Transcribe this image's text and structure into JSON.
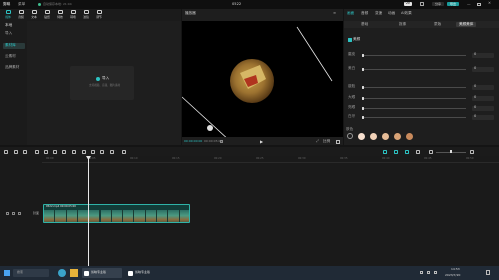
{
  "app": {
    "logo_label": "剪映",
    "menu_label": "菜单",
    "autosave": "自动保存本地: 21:04",
    "title": "0522",
    "pro_badge": "VIP",
    "share_label": "分享",
    "export_label": "导出"
  },
  "toolbar": {
    "items": [
      "媒体",
      "音频",
      "文本",
      "贴纸",
      "特效",
      "转场",
      "滤镜",
      "调节"
    ]
  },
  "leftnav": {
    "items": [
      "本地",
      "导入",
      "素材库",
      "云素材",
      "品牌素材"
    ]
  },
  "media": {
    "import_label": "导入",
    "import_hint": "支持视频、音频、图片素材"
  },
  "player": {
    "title": "播放器",
    "timecode_current": "00:00:00:00",
    "timecode_total": "00:00:05:00",
    "ratio_label": "比例"
  },
  "inspector": {
    "tabs": [
      "画面",
      "音频",
      "变速",
      "动画",
      "AI效果"
    ],
    "subtabs": [
      "基础",
      "抠像",
      "蒙版",
      "美颜美体"
    ],
    "section_label": "美颜",
    "rows": [
      "磨皮",
      "美白",
      "瘦脸",
      "大眼",
      "亮眼",
      "白牙"
    ],
    "swatch_label": "肤色",
    "swatch_colors": [
      "#f7e0cf",
      "#f2d2b8",
      "#e7bd98",
      "#d9a376",
      "#c98a5c"
    ],
    "value_zero": "0"
  },
  "timeline": {
    "ruler_marks": [
      "00:00",
      "00:05",
      "00:10",
      "00:15",
      "00:20",
      "00:25",
      "00:30",
      "00:35",
      "00:40",
      "00:45",
      "00:50"
    ],
    "track_label": "封面",
    "clip_label": "0522.mp4  00:00:05:00"
  },
  "taskbar": {
    "search_placeholder": "搜索",
    "app_label": "剪映专业版",
    "app_label2": "剪映专业版",
    "time": "14:53",
    "date": "2023/7/20"
  }
}
